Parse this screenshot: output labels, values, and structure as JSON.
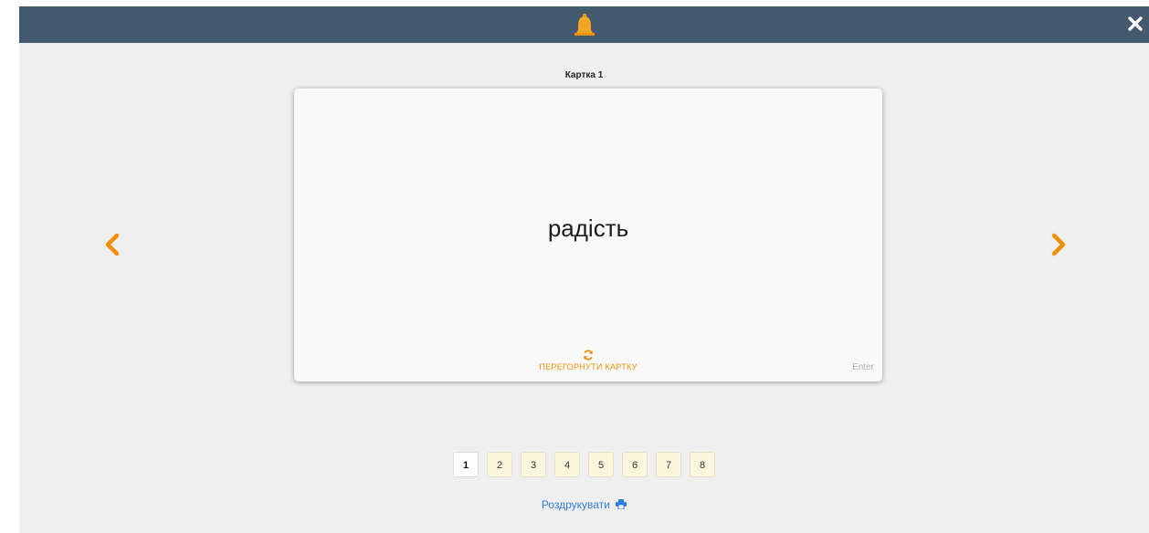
{
  "topbar": {
    "logo_icon": "bell-icon",
    "close_icon": "close-icon",
    "accent_color": "#f0900a",
    "background_color": "#43596d"
  },
  "card": {
    "title": "Картка 1",
    "word": "радість",
    "flip_label": "ПЕРЕГОРНУТИ КАРТКУ",
    "flip_icon": "refresh-icon",
    "enter_hint": "Enter"
  },
  "navigation": {
    "prev_icon": "chevron-left-icon",
    "next_icon": "chevron-right-icon"
  },
  "pager": {
    "current": 1,
    "pages": [
      "1",
      "2",
      "3",
      "4",
      "5",
      "6",
      "7",
      "8"
    ]
  },
  "footer": {
    "print_label": "Роздрукувати",
    "print_icon": "printer-icon",
    "link_color": "#2f7fe0"
  }
}
